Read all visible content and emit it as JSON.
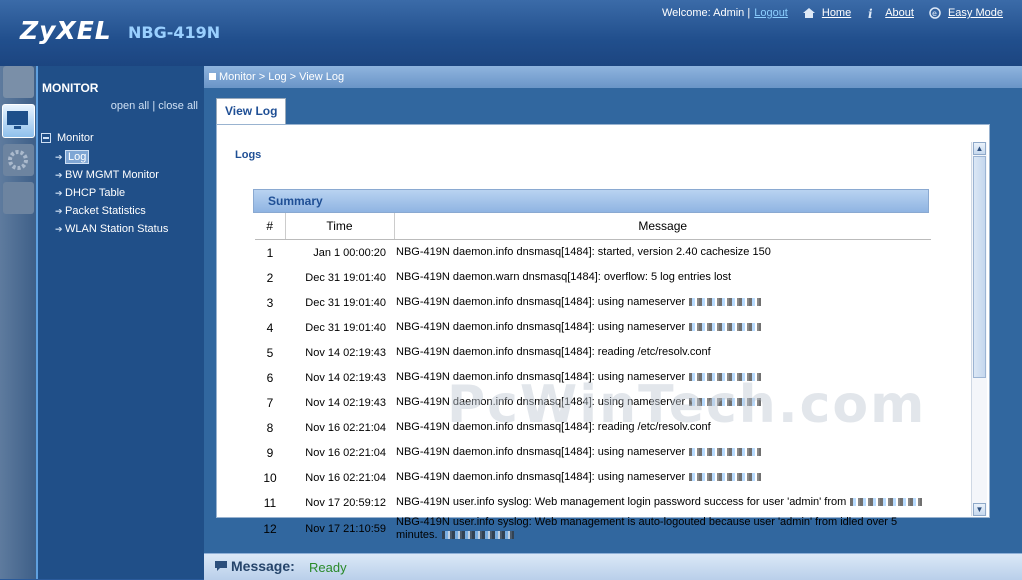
{
  "brand": {
    "logo": "ZyXEL",
    "model": "NBG-419N"
  },
  "topnav": {
    "welcome": "Welcome: Admin |",
    "logout": "Logout",
    "home": "Home",
    "about": "About",
    "easy_mode": "Easy Mode"
  },
  "menu": {
    "title": "MONITOR",
    "open_all": "open all",
    "separator": "|",
    "close_all": "close all",
    "root": "Monitor",
    "items": [
      {
        "label": "Log",
        "selected": true
      },
      {
        "label": "BW MGMT Monitor"
      },
      {
        "label": "DHCP Table"
      },
      {
        "label": "Packet Statistics"
      },
      {
        "label": "WLAN Station Status"
      }
    ]
  },
  "breadcrumb": "Monitor > Log > View Log",
  "tab": "View Log",
  "logs_title": "Logs",
  "summary": "Summary",
  "columns": [
    "#",
    "Time",
    "Message"
  ],
  "rows": [
    {
      "n": "1",
      "time": "Jan 1 00:00:20",
      "msg": "NBG-419N daemon.info dnsmasq[1484]: started, version 2.40 cachesize 150",
      "redacted": false
    },
    {
      "n": "2",
      "time": "Dec 31 19:01:40",
      "msg": "NBG-419N daemon.warn dnsmasq[1484]: overflow: 5 log entries lost",
      "redacted": false
    },
    {
      "n": "3",
      "time": "Dec 31 19:01:40",
      "msg": "NBG-419N daemon.info dnsmasq[1484]: using nameserver",
      "redacted": true
    },
    {
      "n": "4",
      "time": "Dec 31 19:01:40",
      "msg": "NBG-419N daemon.info dnsmasq[1484]: using nameserver",
      "redacted": true
    },
    {
      "n": "5",
      "time": "Nov 14 02:19:43",
      "msg": "NBG-419N daemon.info dnsmasq[1484]: reading /etc/resolv.conf",
      "redacted": false
    },
    {
      "n": "6",
      "time": "Nov 14 02:19:43",
      "msg": "NBG-419N daemon.info dnsmasq[1484]: using nameserver",
      "redacted": true
    },
    {
      "n": "7",
      "time": "Nov 14 02:19:43",
      "msg": "NBG-419N daemon.info dnsmasq[1484]: using nameserver",
      "redacted": true
    },
    {
      "n": "8",
      "time": "Nov 16 02:21:04",
      "msg": "NBG-419N daemon.info dnsmasq[1484]: reading /etc/resolv.conf",
      "redacted": false
    },
    {
      "n": "9",
      "time": "Nov 16 02:21:04",
      "msg": "NBG-419N daemon.info dnsmasq[1484]: using nameserver",
      "redacted": true
    },
    {
      "n": "10",
      "time": "Nov 16 02:21:04",
      "msg": "NBG-419N daemon.info dnsmasq[1484]: using nameserver",
      "redacted": true
    },
    {
      "n": "11",
      "time": "Nov 17 20:59:12",
      "msg": "NBG-419N user.info syslog: Web management login password success for user 'admin' from",
      "redacted": true
    },
    {
      "n": "12",
      "time": "Nov 17 21:10:59",
      "msg": "NBG-419N user.info syslog: Web management is auto-logouted because user 'admin' from idled over 5 minutes.",
      "redacted": true
    }
  ],
  "watermark": "PcWinTech.com",
  "message_bar": {
    "label": "Message:",
    "value": "Ready"
  },
  "colors": {
    "header": "#214f8d",
    "menu": "#204f88",
    "accent": "#1f4f95",
    "ready": "#2a8a2a"
  }
}
